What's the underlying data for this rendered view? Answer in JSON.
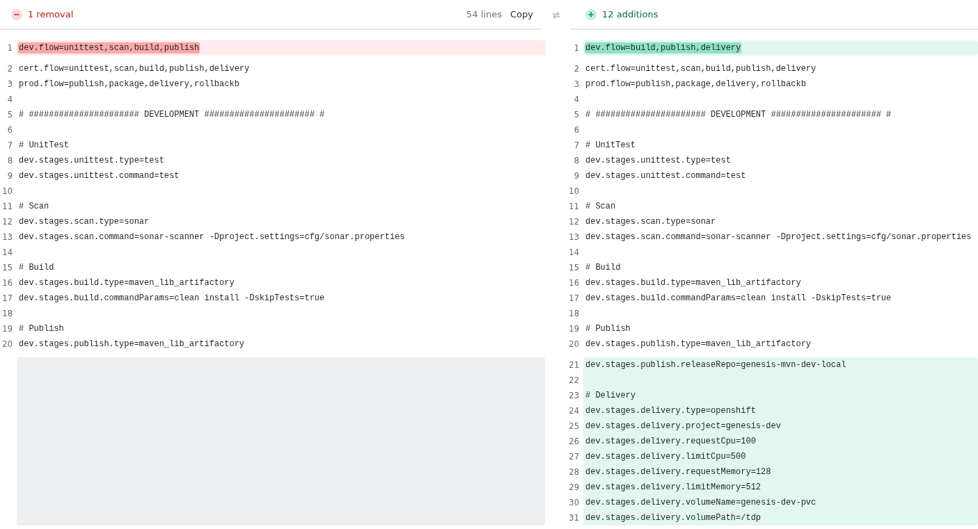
{
  "left": {
    "summary": {
      "kind": "removal",
      "label": "1 removal"
    },
    "line_count": "54 lines",
    "copy_button": "Copy",
    "hunks": [
      {
        "kind": "removed",
        "lines": [
          {
            "number": "1",
            "text": "dev.flow=unittest,scan,build,publish",
            "emphasized": true
          }
        ]
      },
      {
        "kind": "context",
        "lines": [
          {
            "number": "2",
            "text": "cert.flow=unittest,scan,build,publish,delivery"
          },
          {
            "number": "3",
            "text": "prod.flow=publish,package,delivery,rollbackb"
          },
          {
            "number": "4"
          },
          {
            "number": "5",
            "text": "# ###################### DEVELOPMENT ###################### #"
          },
          {
            "number": "6"
          },
          {
            "number": "7",
            "text": "# UnitTest"
          },
          {
            "number": "8",
            "text": "dev.stages.unittest.type=test"
          },
          {
            "number": "9",
            "text": "dev.stages.unittest.command=test"
          },
          {
            "number": "10"
          },
          {
            "number": "11",
            "text": "# Scan"
          },
          {
            "number": "12",
            "text": "dev.stages.scan.type=sonar"
          },
          {
            "number": "13",
            "text": "dev.stages.scan.command=sonar-scanner -Dproject.settings=cfg/sonar.properties"
          },
          {
            "number": "14"
          },
          {
            "number": "15",
            "text": "# Build"
          },
          {
            "number": "16",
            "text": "dev.stages.build.type=maven_lib_artifactory"
          },
          {
            "number": "17",
            "text": "dev.stages.build.commandParams=clean install -DskipTests=true"
          },
          {
            "number": "18"
          },
          {
            "number": "19",
            "text": "# Publish"
          },
          {
            "number": "20",
            "text": "dev.stages.publish.type=maven_lib_artifactory"
          }
        ]
      },
      {
        "kind": "placeholder"
      }
    ]
  },
  "right": {
    "summary": {
      "kind": "addition",
      "label": "12 additions"
    },
    "hunks": [
      {
        "kind": "added",
        "lines": [
          {
            "number": "1",
            "text": "dev.flow=build,publish,delivery",
            "emphasized": true
          }
        ]
      },
      {
        "kind": "context",
        "lines": [
          {
            "number": "2",
            "text": "cert.flow=unittest,scan,build,publish,delivery"
          },
          {
            "number": "3",
            "text": "prod.flow=publish,package,delivery,rollbackb"
          },
          {
            "number": "4"
          },
          {
            "number": "5",
            "text": "# ###################### DEVELOPMENT ###################### #"
          },
          {
            "number": "6"
          },
          {
            "number": "7",
            "text": "# UnitTest"
          },
          {
            "number": "8",
            "text": "dev.stages.unittest.type=test"
          },
          {
            "number": "9",
            "text": "dev.stages.unittest.command=test"
          },
          {
            "number": "10"
          },
          {
            "number": "11",
            "text": "# Scan"
          },
          {
            "number": "12",
            "text": "dev.stages.scan.type=sonar"
          },
          {
            "number": "13",
            "text": "dev.stages.scan.command=sonar-scanner -Dproject.settings=cfg/sonar.properties"
          },
          {
            "number": "14"
          },
          {
            "number": "15",
            "text": "# Build"
          },
          {
            "number": "16",
            "text": "dev.stages.build.type=maven_lib_artifactory"
          },
          {
            "number": "17",
            "text": "dev.stages.build.commandParams=clean install -DskipTests=true"
          },
          {
            "number": "18"
          },
          {
            "number": "19",
            "text": "# Publish"
          },
          {
            "number": "20",
            "text": "dev.stages.publish.type=maven_lib_artifactory"
          }
        ]
      },
      {
        "kind": "added",
        "lines": [
          {
            "number": "21",
            "text": "dev.stages.publish.releaseRepo=genesis-mvn-dev-local"
          },
          {
            "number": "22"
          },
          {
            "number": "23",
            "text": "# Delivery"
          },
          {
            "number": "24",
            "text": "dev.stages.delivery.type=openshift"
          },
          {
            "number": "25",
            "text": "dev.stages.delivery.project=genesis-dev"
          },
          {
            "number": "26",
            "text": "dev.stages.delivery.requestCpu=100"
          },
          {
            "number": "27",
            "text": "dev.stages.delivery.limitCpu=500"
          },
          {
            "number": "28",
            "text": "dev.stages.delivery.requestMemory=128"
          },
          {
            "number": "29",
            "text": "dev.stages.delivery.limitMemory=512"
          },
          {
            "number": "30",
            "text": "dev.stages.delivery.volumeName=genesis-dev-pvc"
          },
          {
            "number": "31",
            "text": "dev.stages.delivery.volumePath=/tdp"
          }
        ]
      }
    ]
  }
}
